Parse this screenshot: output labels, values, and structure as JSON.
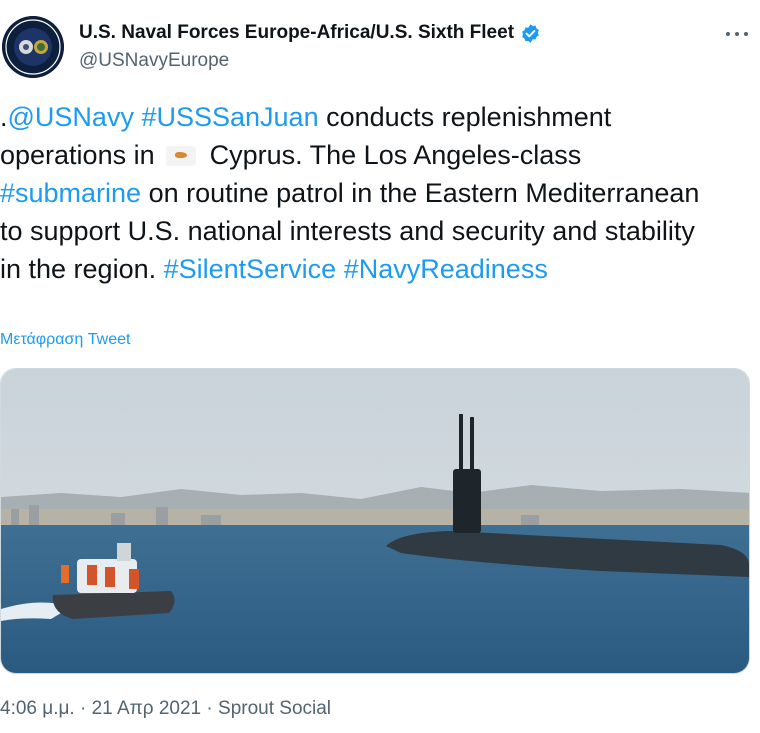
{
  "header": {
    "display_name": "U.S. Naval Forces Europe-Africa/U.S. Sixth Fleet",
    "handle": "@USNavyEurope"
  },
  "tweet": {
    "prefix": ".",
    "mention": "@USNavy",
    "hashtag1": "#USSSanJuan",
    "text1": " conducts replenishment operations in ",
    "flag_name": "Cyprus flag",
    "text2": " Cyprus. The Los Angeles-class ",
    "hashtag2": "#submarine",
    "text3": " on routine patrol in the Eastern Mediterranean to support U.S. national interests and security and stability in the region. ",
    "hashtag3": "#SilentService",
    "hashtag4": "#NavyReadiness"
  },
  "translate_label": "Μετάφραση Tweet",
  "meta": {
    "time": "4:06 μ.μ.",
    "sep1": " · ",
    "date": "21 Απρ 2021",
    "sep2": " · ",
    "source": "Sprout Social"
  },
  "colors": {
    "link": "#1d9bf0",
    "text": "#0f1419",
    "secondary": "#536471",
    "verified": "#1d9bf0"
  },
  "icons": {
    "verified": "verified-badge-icon",
    "more": "more-horizontal-icon"
  }
}
